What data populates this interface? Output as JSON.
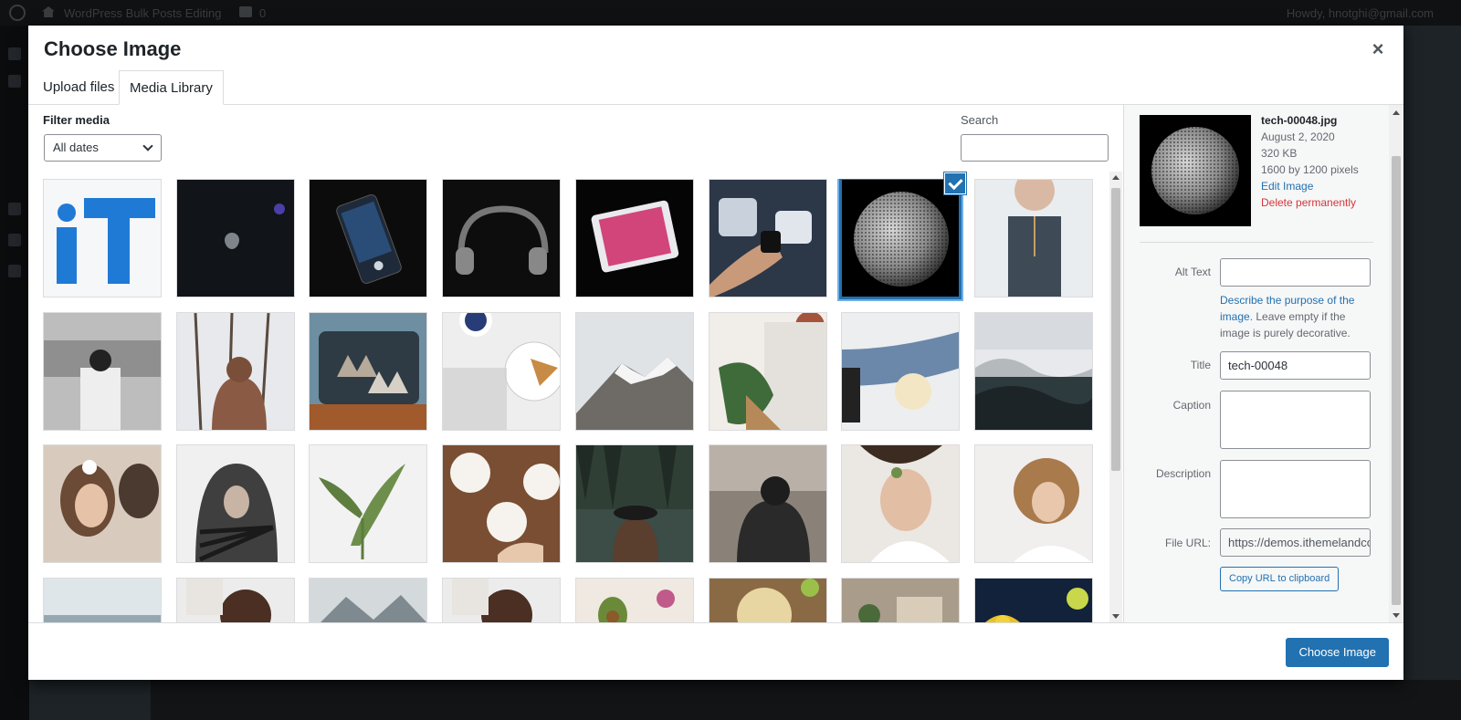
{
  "admin": {
    "site_name": "WordPress Bulk Posts Editing",
    "comments_count": "0",
    "howdy": "Howdy, hnotghi@gmail.com"
  },
  "modal": {
    "title": "Choose Image",
    "close_label": "×",
    "tabs": [
      {
        "label": "Upload files",
        "active": false
      },
      {
        "label": "Media Library",
        "active": true
      }
    ]
  },
  "toolbar": {
    "filter_label": "Filter media",
    "filter_value": "All dates",
    "search_label": "Search",
    "search_value": ""
  },
  "media": [
    {
      "name": "it-logo",
      "selected": false
    },
    {
      "name": "apple-laptop",
      "selected": false
    },
    {
      "name": "phone-music",
      "selected": false
    },
    {
      "name": "headphones",
      "selected": false
    },
    {
      "name": "smartphone-pink",
      "selected": false
    },
    {
      "name": "smartwatch-hand",
      "selected": false
    },
    {
      "name": "tech-00048",
      "selected": true
    },
    {
      "name": "woman-necklace",
      "selected": false
    },
    {
      "name": "subway-woman",
      "selected": false
    },
    {
      "name": "snow-forest-person",
      "selected": false
    },
    {
      "name": "dogs-in-van",
      "selected": false
    },
    {
      "name": "pie-blueberries",
      "selected": false
    },
    {
      "name": "snowy-mountain",
      "selected": false
    },
    {
      "name": "woman-flowers-bouquet",
      "selected": false
    },
    {
      "name": "popcorn-sitting",
      "selected": false
    },
    {
      "name": "foggy-forest",
      "selected": false
    },
    {
      "name": "couple-flower-crown",
      "selected": false
    },
    {
      "name": "hooded-fern",
      "selected": false
    },
    {
      "name": "monstera-leaf",
      "selected": false
    },
    {
      "name": "painting-table",
      "selected": false
    },
    {
      "name": "forest-lake-hat",
      "selected": false
    },
    {
      "name": "street-person",
      "selected": false
    },
    {
      "name": "couple-lying",
      "selected": false
    },
    {
      "name": "curly-hair-woman",
      "selected": false
    },
    {
      "name": "beach",
      "selected": false
    },
    {
      "name": "child-top-view",
      "selected": false
    },
    {
      "name": "mountains-mist",
      "selected": false
    },
    {
      "name": "child-top-view-2",
      "selected": false
    },
    {
      "name": "avocado-food",
      "selected": false
    },
    {
      "name": "pasta-dish",
      "selected": false
    },
    {
      "name": "plants-wood",
      "selected": false
    },
    {
      "name": "lemons-flowers",
      "selected": false
    }
  ],
  "details": {
    "filename": "tech-00048.jpg",
    "date": "August 2, 2020",
    "size": "320 KB",
    "dimensions": "1600 by 1200 pixels",
    "edit_link": "Edit Image",
    "delete_link": "Delete permanently",
    "alt_label": "Alt Text",
    "alt_value": "",
    "alt_help_link": "Describe the purpose of the image",
    "alt_help_rest": ". Leave empty if the image is purely decorative.",
    "title_label": "Title",
    "title_value": "tech-00048",
    "caption_label": "Caption",
    "caption_value": "",
    "description_label": "Description",
    "description_value": "",
    "url_label": "File URL:",
    "url_value": "https://demos.ithemelandco.com/",
    "copy_button": "Copy URL to clipboard"
  },
  "footer": {
    "primary_button": "Choose Image"
  },
  "colors": {
    "accent": "#2271b1",
    "danger": "#d63638",
    "overlay": "#000000"
  }
}
